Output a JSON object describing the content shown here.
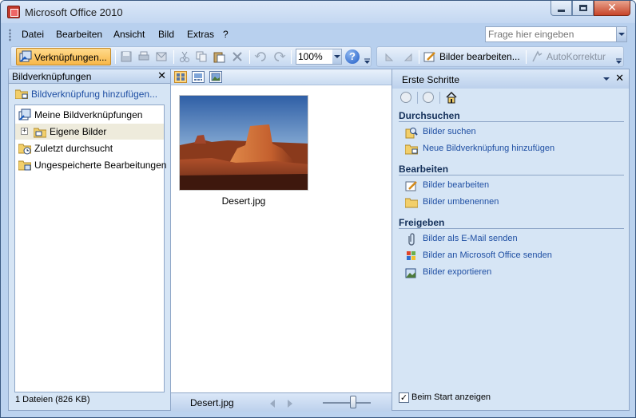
{
  "window": {
    "title": "Microsoft Office 2010"
  },
  "menu": {
    "items": [
      "Datei",
      "Bearbeiten",
      "Ansicht",
      "Bild",
      "Extras",
      "?"
    ],
    "help_placeholder": "Frage hier eingeben"
  },
  "toolbar": {
    "shortcuts_label": "Verknüpfungen...",
    "zoom_value": "100%",
    "edit_pictures_label": "Bilder bearbeiten...",
    "autocorrect_label": "AutoKorrektur"
  },
  "left_panel": {
    "title": "Bildverknüpfungen",
    "add_link": "Bildverknüpfung hinzufügen...",
    "tree": [
      {
        "label": "Meine Bildverknüpfungen"
      },
      {
        "label": "Eigene Bilder"
      },
      {
        "label": "Zuletzt durchsucht"
      },
      {
        "label": "Ungespeicherte Bearbeitungen"
      }
    ],
    "status": "1 Dateien (826 KB)"
  },
  "center": {
    "thumbnail_caption": "Desert.jpg",
    "status_filename": "Desert.jpg"
  },
  "task_pane": {
    "title": "Erste Schritte",
    "sections": [
      {
        "title": "Durchsuchen",
        "links": [
          "Bilder suchen",
          "Neue Bildverknüpfung hinzufügen"
        ]
      },
      {
        "title": "Bearbeiten",
        "links": [
          "Bilder bearbeiten",
          "Bilder umbenennen"
        ]
      },
      {
        "title": "Freigeben",
        "links": [
          "Bilder als E-Mail senden",
          "Bilder an Microsoft Office senden",
          "Bilder exportieren"
        ]
      }
    ],
    "show_at_startup": "Beim Start anzeigen",
    "show_at_startup_checked": true
  },
  "colors": {
    "accent_link": "#1f4fa3",
    "active_button": "#f8b748",
    "frame": "#bcd3ef"
  }
}
